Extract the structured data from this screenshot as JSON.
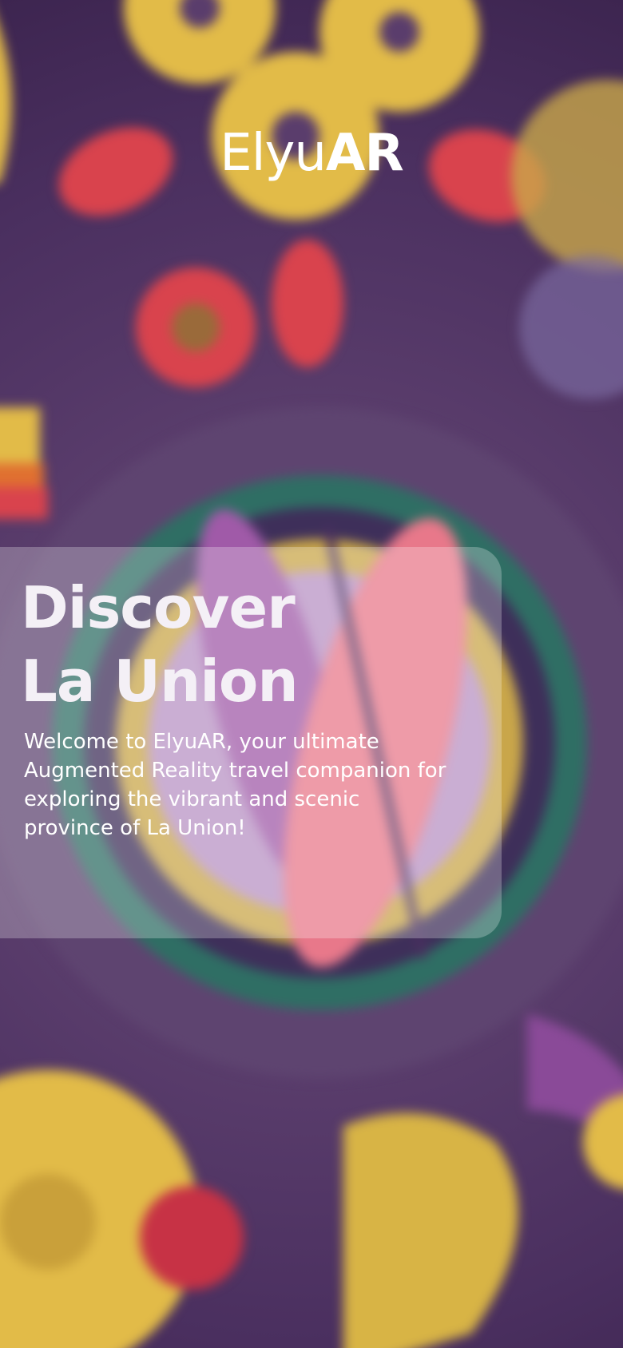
{
  "app": {
    "title_light": "Elyu",
    "title_bold": "AR"
  },
  "hero": {
    "heading_line1": "Discover",
    "heading_line2": "La Union",
    "description": "Welcome to ElyuAR, your ultimate Augmented Reality travel companion for exploring the vibrant and scenic province of La Union!"
  },
  "background": {
    "icon": "floral-mandala-illustration",
    "colors": {
      "purple": "#5a3d6c",
      "yellow": "#e8c24a",
      "red": "#d9434d",
      "teal": "#2f6e64",
      "pink": "#e8788a",
      "lilac": "#c7a2cf"
    }
  }
}
